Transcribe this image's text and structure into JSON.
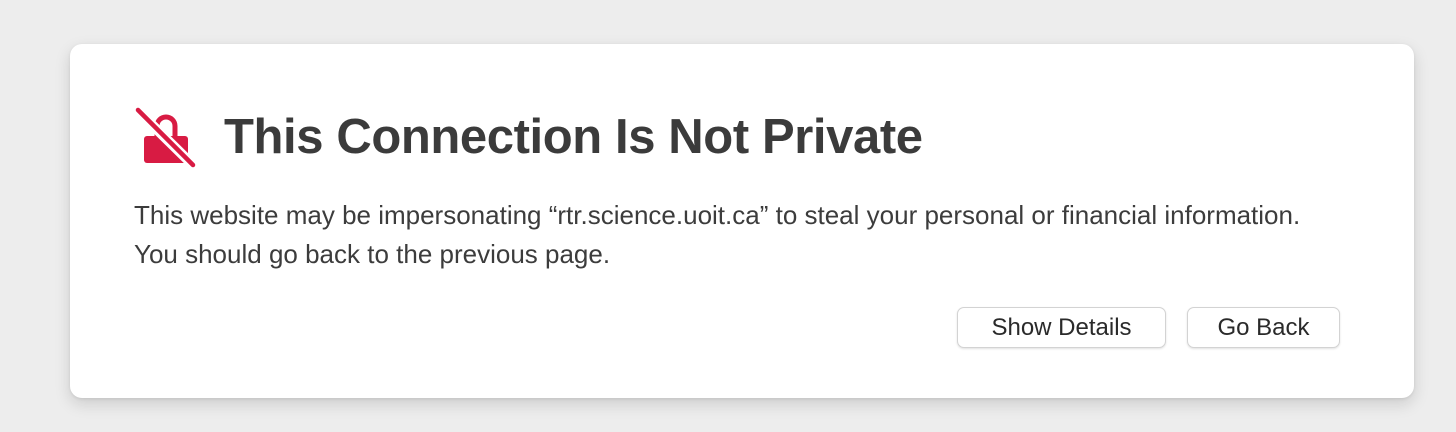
{
  "dialog": {
    "title": "This Connection Is Not Private",
    "message": "This website may be impersonating “rtr.science.uoit.ca” to steal your personal or financial information. You should go back to the previous page.",
    "icon": "unlocked-lock-slash-icon",
    "accent_color": "#d81b43"
  },
  "buttons": {
    "show_details": "Show Details",
    "go_back": "Go Back"
  }
}
